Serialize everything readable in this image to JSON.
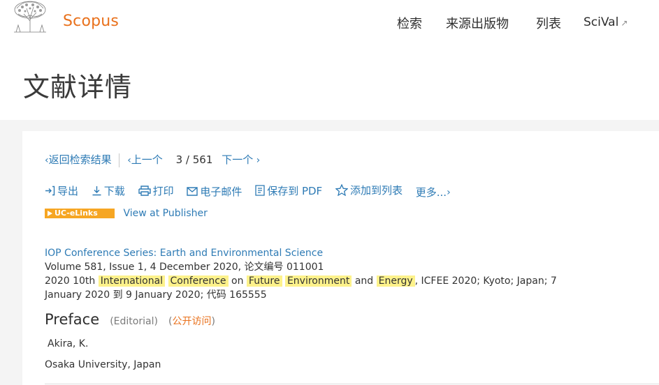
{
  "header": {
    "brand": "Scopus",
    "nav": [
      {
        "label": "检索"
      },
      {
        "label": "来源出版物"
      },
      {
        "label": "列表"
      },
      {
        "label": "SciVal",
        "external_icon": "external-link-icon"
      }
    ]
  },
  "page_title": "文献详情",
  "results_nav": {
    "back_label": "返回检索结果",
    "prev_label": "上一个",
    "current": "3",
    "slash": "/",
    "total": "561",
    "next_label": "下一个"
  },
  "actions": [
    {
      "label": "导出",
      "icon": "export-icon"
    },
    {
      "label": "下载",
      "icon": "download-icon"
    },
    {
      "label": "打印",
      "icon": "print-icon"
    },
    {
      "label": "电子邮件",
      "icon": "email-icon"
    },
    {
      "label": "保存到 PDF",
      "icon": "pdf-icon"
    },
    {
      "label": "添加到列表",
      "icon": "star-icon"
    },
    {
      "label": "更多...",
      "icon": "chevron-right-icon"
    }
  ],
  "links": {
    "uc_elinks": "UC-eLinks",
    "view_publisher": "View at Publisher"
  },
  "source": {
    "title": "IOP Conference Series: Earth and Environmental Science",
    "volume_line": "Volume 581, Issue 1, 4 December 2020, 论文编号 011001",
    "conf_prefix": "2020 10th",
    "hl_international": "International",
    "hl_conference": "Conference",
    "word_on": "on",
    "hl_future": "Future",
    "hl_environment": "Environment",
    "word_and": "and",
    "hl_energy": "Energy",
    "conf_suffix": ", ICFEE 2020; Kyoto; Japan; 7",
    "date_line": "January 2020 到 9 January 2020; 代码 165555"
  },
  "document": {
    "title": "Preface",
    "type": "(Editorial)",
    "paren_open": "(",
    "open_access": "公开访问",
    "paren_close": ")",
    "author": "Akira, K.",
    "affiliation": "Osaka University, Japan"
  },
  "colors": {
    "brand_orange": "#e9711c",
    "link_blue": "#2e7bb5",
    "highlight": "#fdf28b",
    "badge": "#f6a623"
  }
}
